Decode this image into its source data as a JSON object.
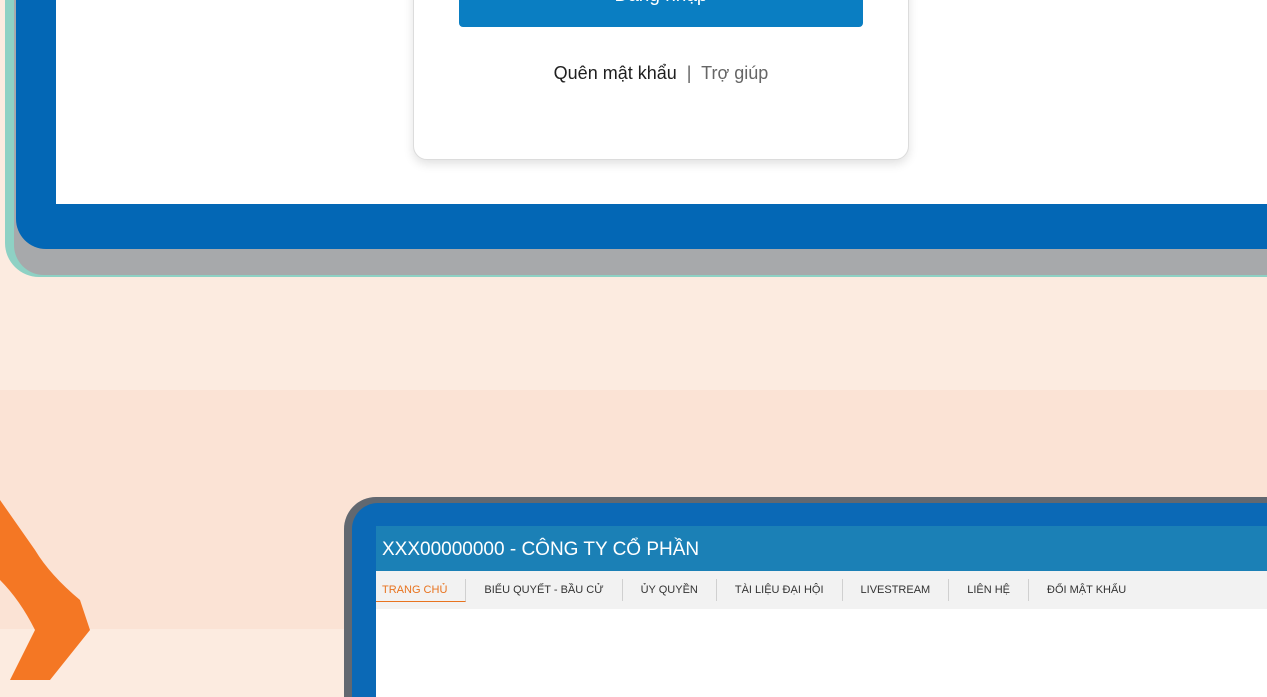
{
  "login": {
    "button_label": "Đăng nhập",
    "forgot_password": "Quên mật khẩu",
    "separator": "|",
    "help": "Trợ giúp"
  },
  "app": {
    "header_title": "XXX00000000 - CÔNG TY CỔ PHẦN",
    "nav": [
      {
        "label": "TRANG CHỦ",
        "active": true
      },
      {
        "label": "BIỂU QUYẾT - BẦU CỬ",
        "active": false
      },
      {
        "label": "ỦY QUYỀN",
        "active": false
      },
      {
        "label": "TÀI LIỆU ĐẠI HỘI",
        "active": false
      },
      {
        "label": "LIVESTREAM",
        "active": false
      },
      {
        "label": "LIÊN HỆ",
        "active": false
      },
      {
        "label": "ĐỔI MẬT KHẨU",
        "active": false
      }
    ]
  },
  "colors": {
    "device_blue": "#0367b5",
    "button_blue": "#0a7ec2",
    "header_blue": "#1b80b6",
    "accent_orange": "#e8731f",
    "background_peach": "#fcebe0"
  }
}
